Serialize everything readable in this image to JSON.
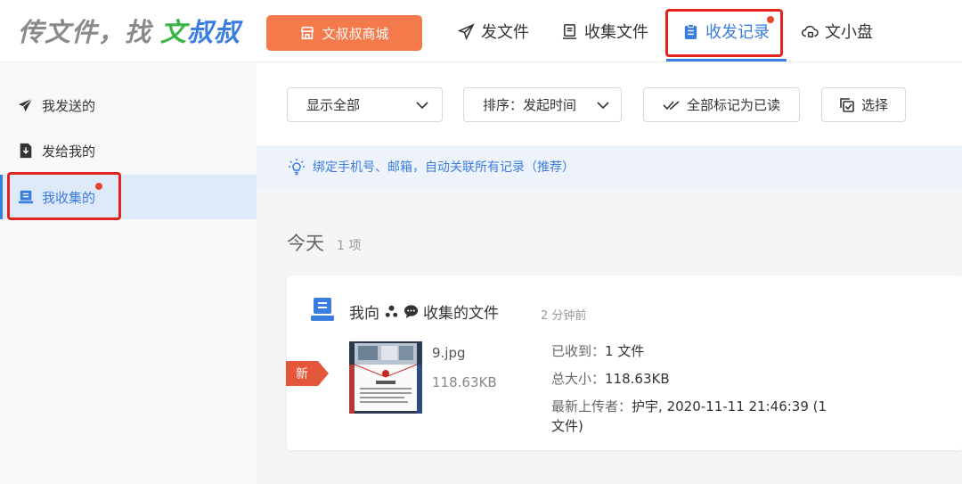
{
  "header": {
    "logo_part1": "传文件，找",
    "logo_part2": "文",
    "logo_part3": "叔叔",
    "mall_button": "文叔叔商城",
    "nav": {
      "send": "发文件",
      "collect": "收集文件",
      "records": "收发记录",
      "disk": "文小盘"
    }
  },
  "sidebar": {
    "items": [
      {
        "label": "我发送的"
      },
      {
        "label": "发给我的"
      },
      {
        "label": "我收集的"
      }
    ]
  },
  "toolbar": {
    "filter_value": "显示全部",
    "sort_value": "排序：发起时间",
    "mark_all_read": "全部标记为已读",
    "select": "选择"
  },
  "tip": "绑定手机号、邮箱，自动关联所有记录（推荐）",
  "group": {
    "title": "今天",
    "count": "1 项"
  },
  "card": {
    "title_prefix": "我向",
    "title_suffix": "收集的文件",
    "time": "2 分钟前",
    "new_tag": "新",
    "file_name": "9.jpg",
    "file_size": "118.63KB",
    "received_label": "已收到：",
    "received_value": "1 文件",
    "total_label": "总大小：",
    "total_value": "118.63KB",
    "uploader_label": "最新上传者：",
    "uploader_name": "护宇",
    "uploader_detail": ", 2020-11-11 21:46:39 (1 文件)"
  },
  "colors": {
    "accent": "#3a7de0",
    "brand_orange": "#f47a4b",
    "highlight_red": "#e5231e",
    "new_tag": "#e4573a"
  }
}
